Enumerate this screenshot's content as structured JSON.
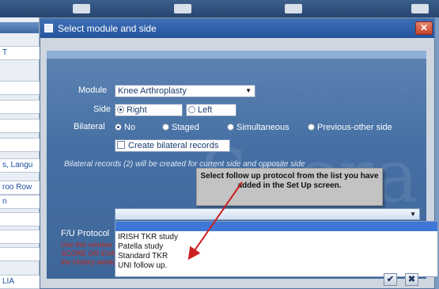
{
  "background": {
    "left_rows": [
      "T",
      "s, Langu",
      "roo Row",
      "n",
      "LIA"
    ]
  },
  "dialog": {
    "title": "Select module and side",
    "close_glyph": "✕",
    "watermark": "Socra",
    "module": {
      "label": "Module",
      "value": "Knee Arthroplasty"
    },
    "side": {
      "label": "Side",
      "options": [
        "Right",
        "Left"
      ],
      "selected": "Right"
    },
    "bilateral": {
      "label": "Bilateral",
      "options": [
        "No",
        "Staged",
        "Simultaneous",
        "Previous-other side"
      ],
      "selected": "No"
    },
    "create_bilateral_label": "Create bilateral records",
    "bilateral_info": "Bilateral records (2) will be created  for current side and opposite side",
    "callout": "Select  follow up protocol from the list you have added in the Set Up screen.",
    "fu_protocol": {
      "label": "F/U Protocol",
      "value": "",
      "options": [
        "IRISH TKR study",
        "Patella study",
        "Standard TKR",
        "UNI follow up."
      ]
    },
    "red_note": [
      "Use this window to",
      "SCORE OR EVAL",
      "the History window"
    ],
    "ok_glyph": "✔",
    "cancel_glyph": "✖"
  },
  "colors": {
    "panel": "#4670a4",
    "titlebar": "#2b5ea8",
    "arrow": "#cc1f1f",
    "selection_band": "#3e77d6"
  }
}
